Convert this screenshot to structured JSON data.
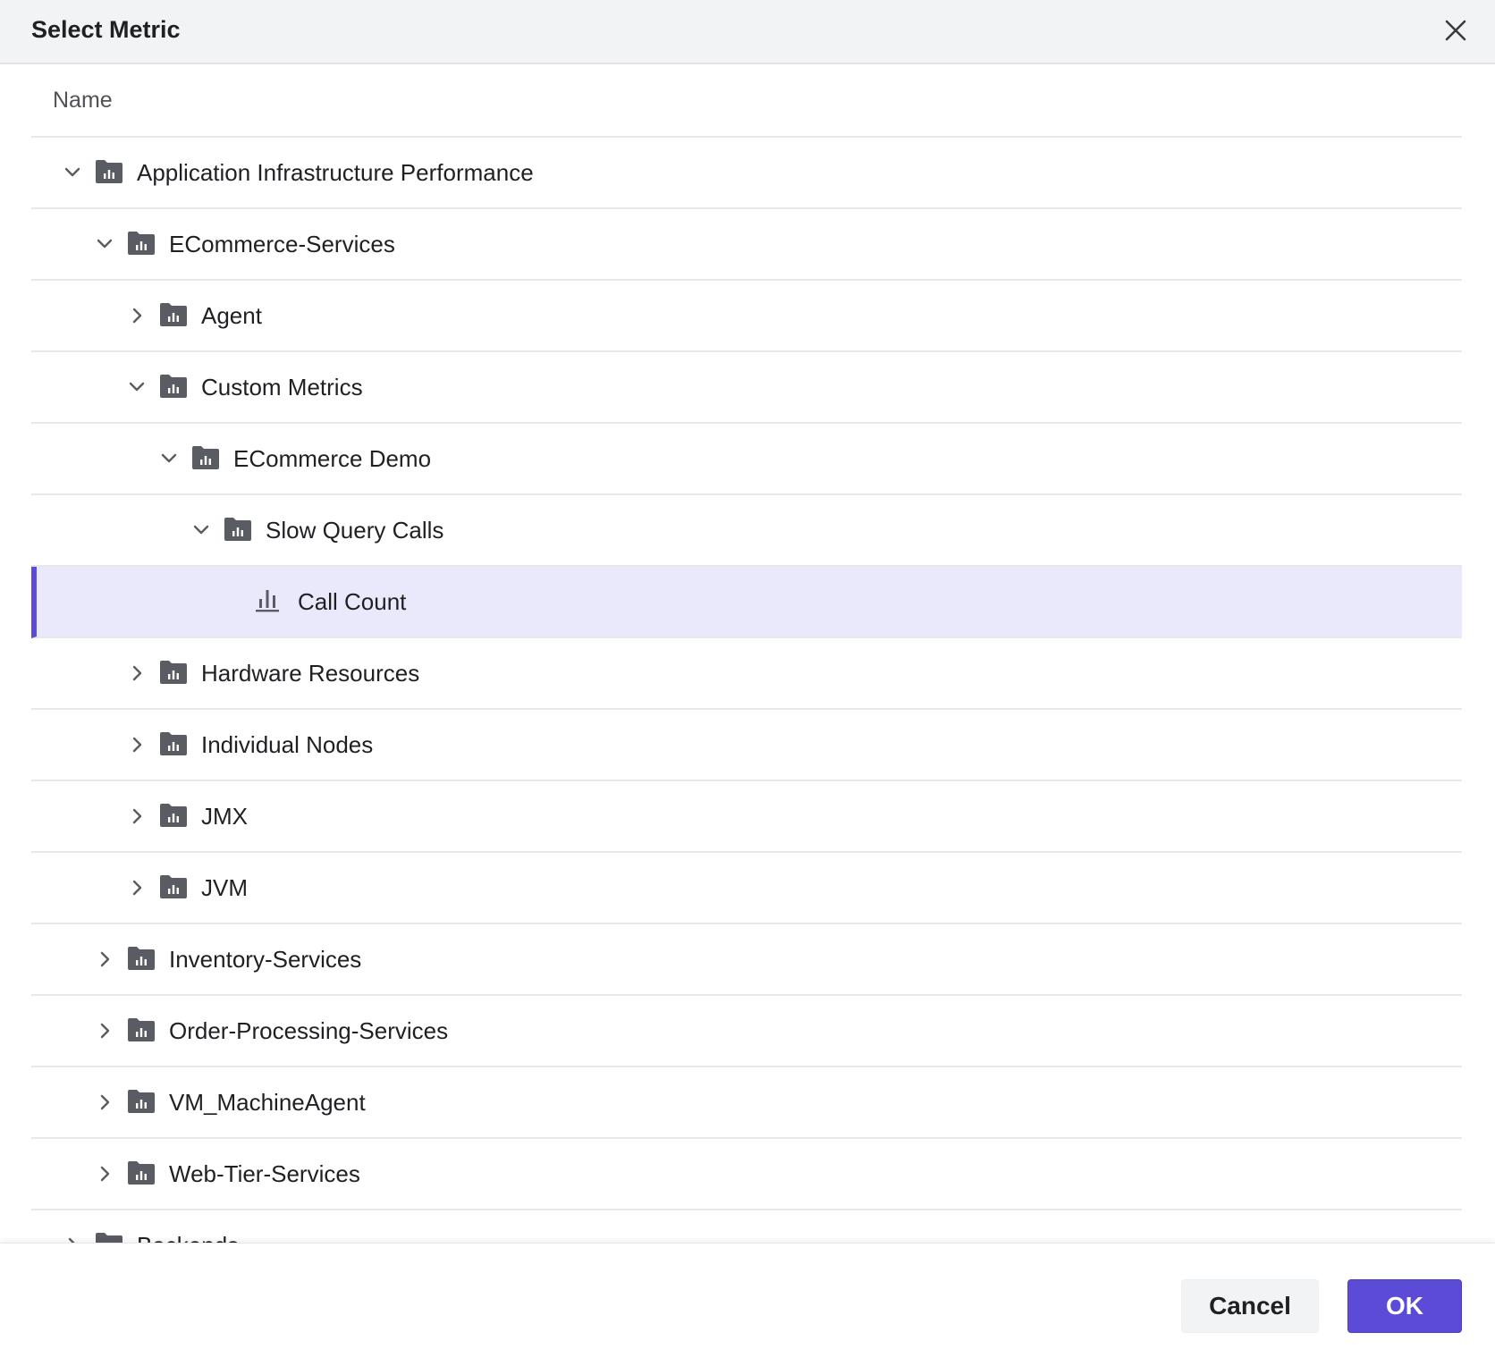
{
  "dialog": {
    "title": "Select Metric",
    "close_icon": "close-icon"
  },
  "columns": {
    "name": "Name"
  },
  "tree": {
    "rows": [
      {
        "label": "Application Infrastructure Performance",
        "depth": 0,
        "state": "expanded",
        "type": "folder"
      },
      {
        "label": "ECommerce-Services",
        "depth": 1,
        "state": "expanded",
        "type": "folder"
      },
      {
        "label": "Agent",
        "depth": 2,
        "state": "collapsed",
        "type": "folder"
      },
      {
        "label": "Custom Metrics",
        "depth": 2,
        "state": "expanded",
        "type": "folder"
      },
      {
        "label": "ECommerce Demo",
        "depth": 3,
        "state": "expanded",
        "type": "folder"
      },
      {
        "label": "Slow Query Calls",
        "depth": 4,
        "state": "expanded",
        "type": "folder"
      },
      {
        "label": "Call Count",
        "depth": 5,
        "state": "leaf",
        "type": "metric",
        "selected": true
      },
      {
        "label": "Hardware Resources",
        "depth": 2,
        "state": "collapsed",
        "type": "folder"
      },
      {
        "label": "Individual Nodes",
        "depth": 2,
        "state": "collapsed",
        "type": "folder"
      },
      {
        "label": "JMX",
        "depth": 2,
        "state": "collapsed",
        "type": "folder"
      },
      {
        "label": "JVM",
        "depth": 2,
        "state": "collapsed",
        "type": "folder"
      },
      {
        "label": "Inventory-Services",
        "depth": 1,
        "state": "collapsed",
        "type": "folder"
      },
      {
        "label": "Order-Processing-Services",
        "depth": 1,
        "state": "collapsed",
        "type": "folder"
      },
      {
        "label": "VM_MachineAgent",
        "depth": 1,
        "state": "collapsed",
        "type": "folder"
      },
      {
        "label": "Web-Tier-Services",
        "depth": 1,
        "state": "collapsed",
        "type": "folder"
      },
      {
        "label": "Backends",
        "depth": 0,
        "state": "collapsed",
        "type": "folder"
      }
    ]
  },
  "footer": {
    "cancel_label": "Cancel",
    "ok_label": "OK"
  },
  "colors": {
    "accent": "#5b4bd6",
    "selected_row": "#e9e9fb",
    "header_bg": "#f2f3f5",
    "icon": "#5a5c63"
  }
}
